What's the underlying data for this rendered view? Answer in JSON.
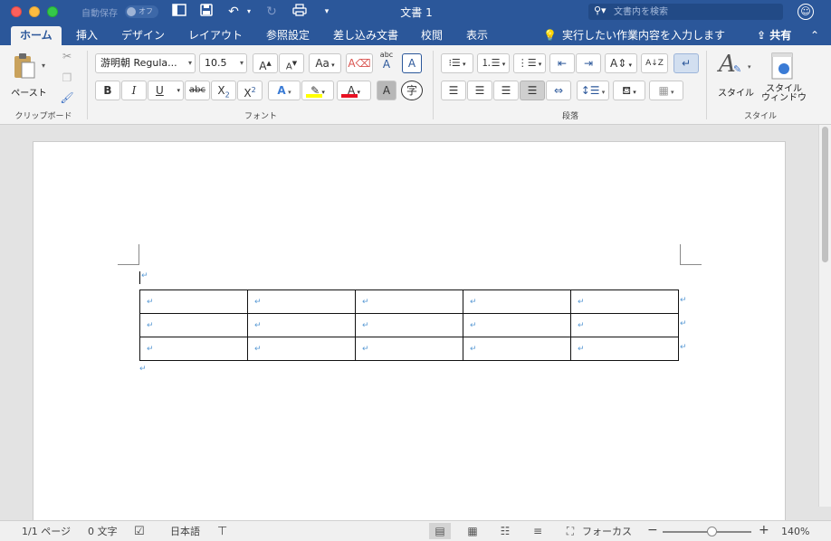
{
  "titlebar": {
    "autosave_label": "自動保存",
    "autosave_state": "オフ",
    "document_title": "文書 1",
    "search_placeholder": "文書内を検索"
  },
  "tabs": [
    {
      "label": "ホーム",
      "active": true
    },
    {
      "label": "挿入"
    },
    {
      "label": "デザイン"
    },
    {
      "label": "レイアウト"
    },
    {
      "label": "参照設定"
    },
    {
      "label": "差し込み文書"
    },
    {
      "label": "校閲"
    },
    {
      "label": "表示"
    }
  ],
  "tellme": {
    "text": "実行したい作業内容を入力します"
  },
  "share": {
    "label": "共有"
  },
  "ribbon": {
    "clipboard": {
      "paste_label": "ペースト",
      "group_label": "クリップボード"
    },
    "font": {
      "font_name": "游明朝 Regula...",
      "font_size": "10.5",
      "group_label": "フォント",
      "bold": "B",
      "italic": "I",
      "underline": "U",
      "strikethrough": "abc",
      "subscript_base": "X",
      "subscript_mark": "2",
      "superscript_base": "X",
      "superscript_mark": "2",
      "grow": "A",
      "shrink": "A",
      "case": "Aa",
      "phonetic": "abc",
      "phonetic_A": "A",
      "border_char": "A",
      "effects": "A",
      "font_color": "A",
      "shading_char": "A",
      "enclose": "字"
    },
    "paragraph": {
      "group_label": "段落"
    },
    "styles": {
      "styles_label": "スタイル",
      "pane_label_1": "スタイル",
      "pane_label_2": "ウィンドウ",
      "group_label": "スタイル"
    }
  },
  "document": {
    "table": {
      "rows": 3,
      "cols": 5
    }
  },
  "statusbar": {
    "page": "1/1 ページ",
    "words": "0 文字",
    "language": "日本語",
    "focus": "フォーカス",
    "zoom_minus": "−",
    "zoom_plus": "+",
    "zoom": "140%",
    "zoom_level": 0.55
  },
  "colors": {
    "accent": "#2b579a",
    "font_color_bar": "#e81123",
    "highlight_bar": "#ffff00",
    "paragraph_mark": "#5b9bd5"
  }
}
